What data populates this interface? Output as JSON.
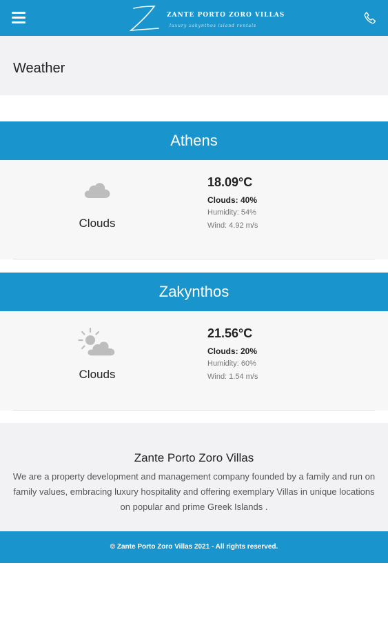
{
  "header": {
    "brand_title": "ZANTE PORTO ZORO VILLAS",
    "brand_tagline": "luxury zakynthos island rentals",
    "menu_icon": "hamburger-icon",
    "phone_icon": "phone-icon",
    "brand_color": "#1a94cc"
  },
  "page": {
    "title": "Weather"
  },
  "weather": [
    {
      "city": "Athens",
      "condition": "Clouds",
      "icon": "cloud-icon",
      "temperature": "18.09°C",
      "clouds": "Clouds: 40%",
      "humidity": "Humidity: 54%",
      "wind": "Wind: 4.92 m/s"
    },
    {
      "city": "Zakynthos",
      "condition": "Clouds",
      "icon": "partly-cloudy-icon",
      "temperature": "21.56°C",
      "clouds": "Clouds: 20%",
      "humidity": "Humidity: 60%",
      "wind": "Wind: 1.54 m/s"
    }
  ],
  "about": {
    "title": "Zante Porto Zoro Villas",
    "text": "We are a property development and management company founded by a family and run on family values, embracing luxury hospitality and offering exemplary Villas in unique locations on popular and prime Greek Islands ."
  },
  "footer": {
    "copyright": "© Zante Porto Zoro Villas 2021 - All rights reserved."
  }
}
